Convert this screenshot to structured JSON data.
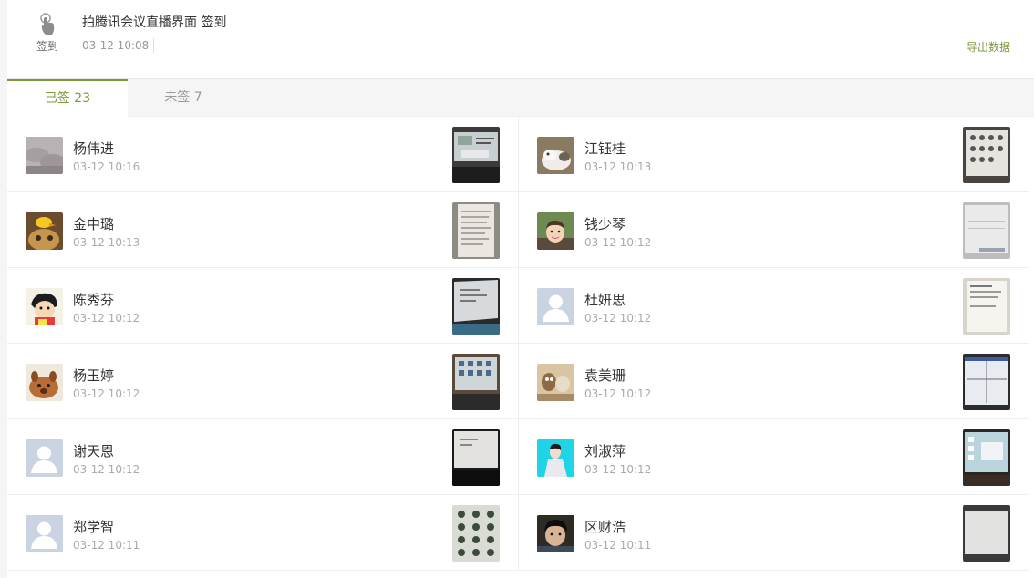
{
  "header": {
    "title": "拍腾讯会议直播界面 签到",
    "time": "03-12 10:08",
    "sign_caption": "签到",
    "export_label": "导出数据",
    "accent_color": "#7a9a3a"
  },
  "tabs": [
    {
      "label": "已签 23",
      "active": true
    },
    {
      "label": "未签 7",
      "active": false
    }
  ],
  "records": [
    {
      "name": "杨伟进",
      "time": "03-12 10:16",
      "avatar": "sky-photo",
      "photo": "laptop-screen-photo"
    },
    {
      "name": "江钰桂",
      "time": "03-12 10:13",
      "avatar": "cat-photo",
      "photo": "icon-grid-screen-photo"
    },
    {
      "name": "金中璐",
      "time": "03-12 10:13",
      "avatar": "duck-cat-photo",
      "photo": "notebook-page-photo"
    },
    {
      "name": "钱少琴",
      "time": "03-12 10:12",
      "avatar": "child-photo",
      "photo": "white-screen-photo"
    },
    {
      "name": "陈秀芬",
      "time": "03-12 10:12",
      "avatar": "cartoon-boy",
      "photo": "tilted-screen-photo"
    },
    {
      "name": "杜妍思",
      "time": "03-12 10:12",
      "avatar": "default-user",
      "photo": "paper-document-photo"
    },
    {
      "name": "杨玉婷",
      "time": "03-12 10:12",
      "avatar": "cartoon-dog",
      "photo": "laptop-icons-photo"
    },
    {
      "name": "袁美珊",
      "time": "03-12 10:12",
      "avatar": "figurines-photo",
      "photo": "monitor-photo"
    },
    {
      "name": "谢天恩",
      "time": "03-12 10:12",
      "avatar": "default-user",
      "photo": "dark-laptop-photo"
    },
    {
      "name": "刘淑萍",
      "time": "03-12 10:12",
      "avatar": "person-photo",
      "photo": "desktop-screen-photo"
    },
    {
      "name": "郑学智",
      "time": "03-12 10:11",
      "avatar": "default-user",
      "photo": "phone-avatars-photo"
    },
    {
      "name": "区财浩",
      "time": "03-12 10:11",
      "avatar": "boy-photo",
      "photo": "blank-screen-photo"
    }
  ]
}
